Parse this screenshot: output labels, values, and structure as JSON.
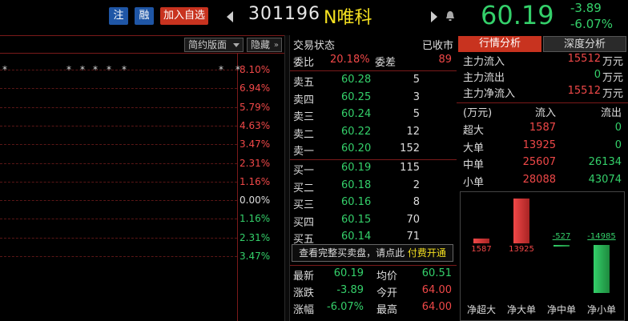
{
  "header": {
    "tag_zhu": "注",
    "tag_rong": "融",
    "add_watchlist": "加入自选",
    "code": "301196",
    "name": "N唯科",
    "price": "60.19",
    "change": "-3.89",
    "change_pct": "-6.07%"
  },
  "chart": {
    "btn_simple": "简约版面",
    "btn_hide": "隐藏",
    "axis_labels": [
      "8.10%",
      "6.94%",
      "5.79%",
      "4.63%",
      "3.47%",
      "2.31%",
      "1.16%",
      "0.00%",
      "1.16%",
      "2.31%",
      "3.47%"
    ],
    "star": "*",
    "colors": {
      "up": "#f04848",
      "down": "#34d06a",
      "flat": "#dddddd"
    }
  },
  "book": {
    "status_label": "交易状态",
    "status_value": "已收市",
    "weibi_label": "委比",
    "weibi_value": "20.18%",
    "weicha_label": "委差",
    "weicha_value": "89",
    "sells": [
      {
        "label": "卖五",
        "price": "60.28",
        "vol": "5"
      },
      {
        "label": "卖四",
        "price": "60.25",
        "vol": "3"
      },
      {
        "label": "卖三",
        "price": "60.24",
        "vol": "5"
      },
      {
        "label": "卖二",
        "price": "60.22",
        "vol": "12"
      },
      {
        "label": "卖一",
        "price": "60.20",
        "vol": "152"
      }
    ],
    "buys": [
      {
        "label": "买一",
        "price": "60.19",
        "vol": "115"
      },
      {
        "label": "买二",
        "price": "60.18",
        "vol": "2"
      },
      {
        "label": "买三",
        "price": "60.16",
        "vol": "8"
      },
      {
        "label": "买四",
        "price": "60.15",
        "vol": "70"
      },
      {
        "label": "买五",
        "price": "60.14",
        "vol": "71"
      }
    ],
    "full_book_text": "查看完整买卖盘，请点此",
    "full_book_link": "付费开通",
    "stats": [
      {
        "l1": "最新",
        "v1": "60.19",
        "l2": "均价",
        "v2": "60.51"
      },
      {
        "l1": "涨跌",
        "v1": "-3.89",
        "l2": "今开",
        "v2": "64.00"
      },
      {
        "l1": "涨幅",
        "v1": "-6.07%",
        "l2": "最高",
        "v2": "64.00"
      }
    ]
  },
  "flow": {
    "tab_flow": "行情分析",
    "tab_depth": "深度分析",
    "unit": "万元",
    "summary": [
      {
        "label": "主力流入",
        "value": "15512"
      },
      {
        "label": "主力流出",
        "value": "0"
      },
      {
        "label": "主力净流入",
        "value": "15512"
      }
    ],
    "table_header": {
      "c0": "(万元)",
      "c1": "流入",
      "c2": "流出"
    },
    "table_rows": [
      {
        "label": "超大",
        "in": "1587",
        "out": "0"
      },
      {
        "label": "大单",
        "in": "13925",
        "out": "0"
      },
      {
        "label": "中单",
        "in": "25607",
        "out": "26134"
      },
      {
        "label": "小单",
        "in": "28088",
        "out": "43074"
      }
    ]
  },
  "chart_data": {
    "type": "bar",
    "categories": [
      "净超大",
      "净大单",
      "净中单",
      "净小单"
    ],
    "values": [
      1587,
      13925,
      -527,
      -14985
    ],
    "ylim": [
      -16000,
      16000
    ],
    "grid": false,
    "colors": {
      "positive": "#f04848",
      "negative": "#34d06a"
    }
  }
}
